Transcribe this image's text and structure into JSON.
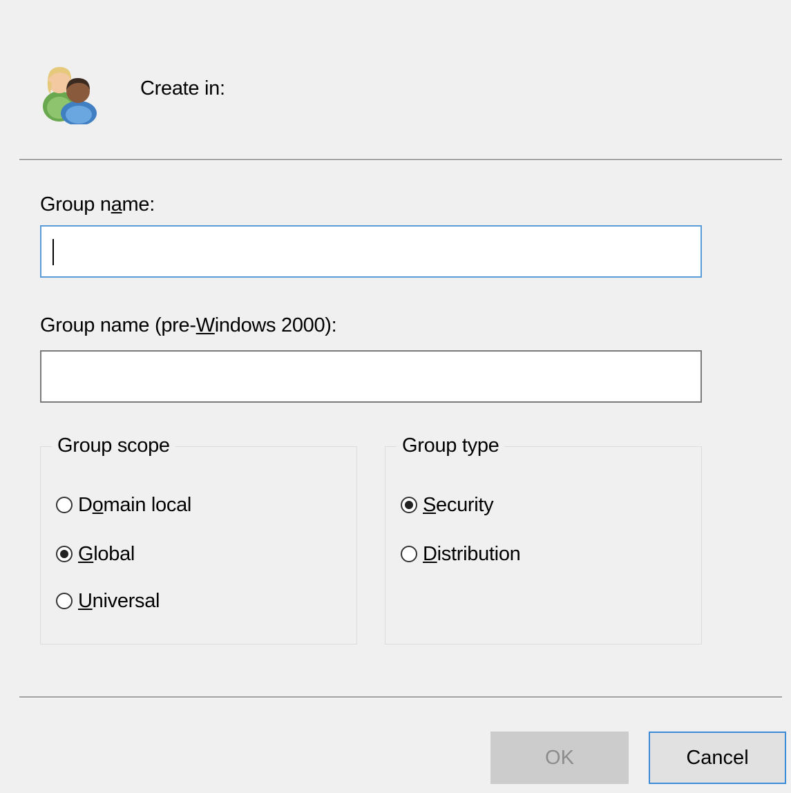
{
  "header": {
    "icon": "users-group-icon",
    "create_in_label": "Create in:"
  },
  "fields": {
    "group_name": {
      "label_pre": "Group n",
      "label_key": "a",
      "label_post": "me:",
      "value": "",
      "focused": true
    },
    "group_name_pre2000": {
      "label_pre": "Group name (pre-",
      "label_key": "W",
      "label_post": "indows 2000):",
      "value": ""
    }
  },
  "group_scope": {
    "legend": "Group scope",
    "options": [
      {
        "pre": "D",
        "key": "o",
        "post": "main local",
        "checked": false
      },
      {
        "pre": "",
        "key": "G",
        "post": "lobal",
        "checked": true
      },
      {
        "pre": "",
        "key": "U",
        "post": "niversal",
        "checked": false
      }
    ]
  },
  "group_type": {
    "legend": "Group type",
    "options": [
      {
        "pre": "",
        "key": "S",
        "post": "ecurity",
        "checked": true
      },
      {
        "pre": "",
        "key": "D",
        "post": "istribution",
        "checked": false
      }
    ]
  },
  "buttons": {
    "ok": "OK",
    "cancel": "Cancel"
  },
  "colors": {
    "focus_border": "#5a9ad8",
    "default_button_border": "#3c8bd6",
    "disabled_button_bg": "#cccccc"
  }
}
